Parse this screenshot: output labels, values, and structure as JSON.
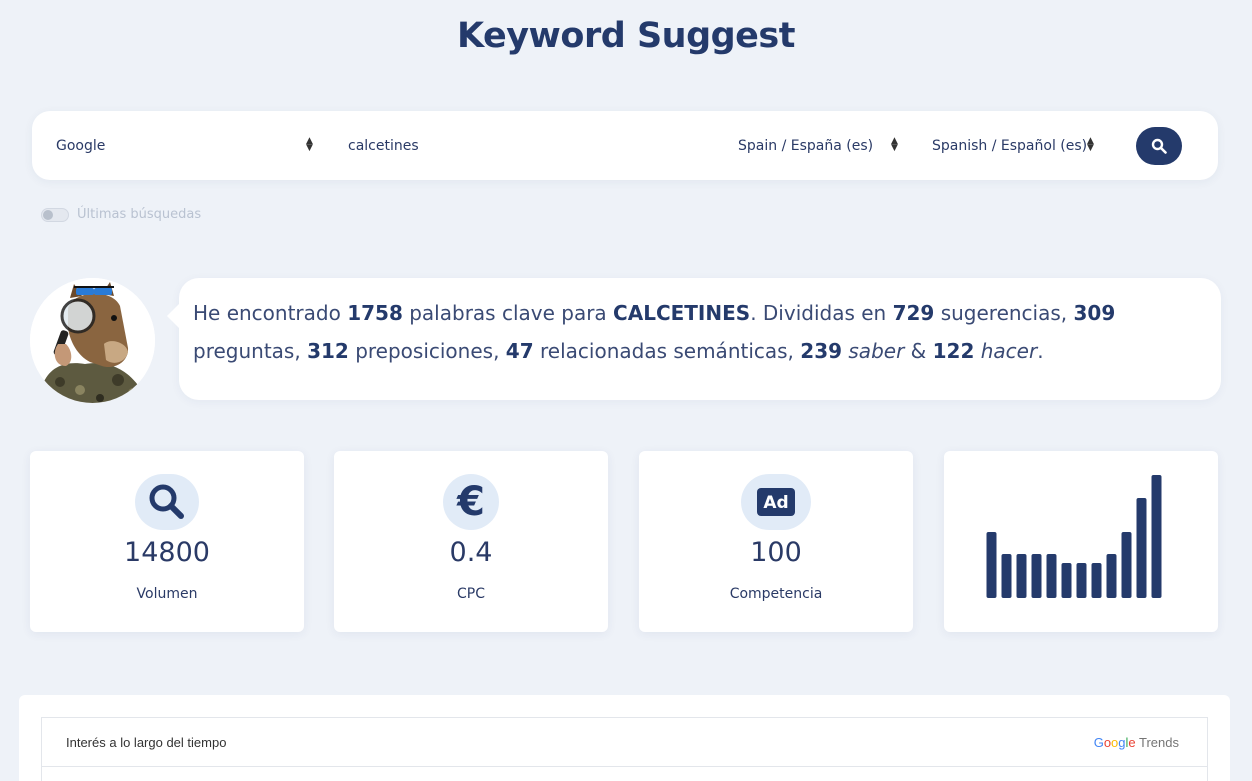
{
  "header": {
    "title": "Keyword Suggest"
  },
  "search": {
    "engine": "Google",
    "query": "calcetines",
    "country": "Spain / España (es)",
    "language": "Spanish / Español (es)",
    "search_icon": "search-icon"
  },
  "history_toggle": {
    "label": "Últimas búsquedas",
    "on": false
  },
  "summary": {
    "p1": "He encontrado",
    "total": "1758",
    "p2": "palabras clave para",
    "keyword": "CALCETINES",
    "p3": ". Divididas en",
    "suggestions": "729",
    "p4": "sugerencias,",
    "questions": "309",
    "p5": "preguntas,",
    "prepositions": "312",
    "p6": "preposiciones,",
    "semantic": "47",
    "p7": "relacionadas semánticas,",
    "saber_count": "239",
    "saber": "saber",
    "amp": "&",
    "hacer_count": "122",
    "hacer": "hacer",
    "end": "."
  },
  "metrics": [
    {
      "icon": "search-icon",
      "value": "14800",
      "label": "Volumen"
    },
    {
      "icon": "euro-icon",
      "value": "0.4",
      "label": "CPC"
    },
    {
      "icon": "ad-icon",
      "value": "100",
      "label": "Competencia"
    }
  ],
  "chart_data": {
    "type": "bar",
    "values": [
      66,
      44,
      44,
      44,
      44,
      35,
      35,
      35,
      44,
      66,
      100,
      123
    ]
  },
  "trends": {
    "title": "Interés a lo largo del tiempo",
    "brand_google": "Google",
    "brand_trends": "Trends"
  },
  "colors": {
    "accent": "#243a6b",
    "icon_bg": "#e1ebf7",
    "background": "#eef2f8"
  }
}
